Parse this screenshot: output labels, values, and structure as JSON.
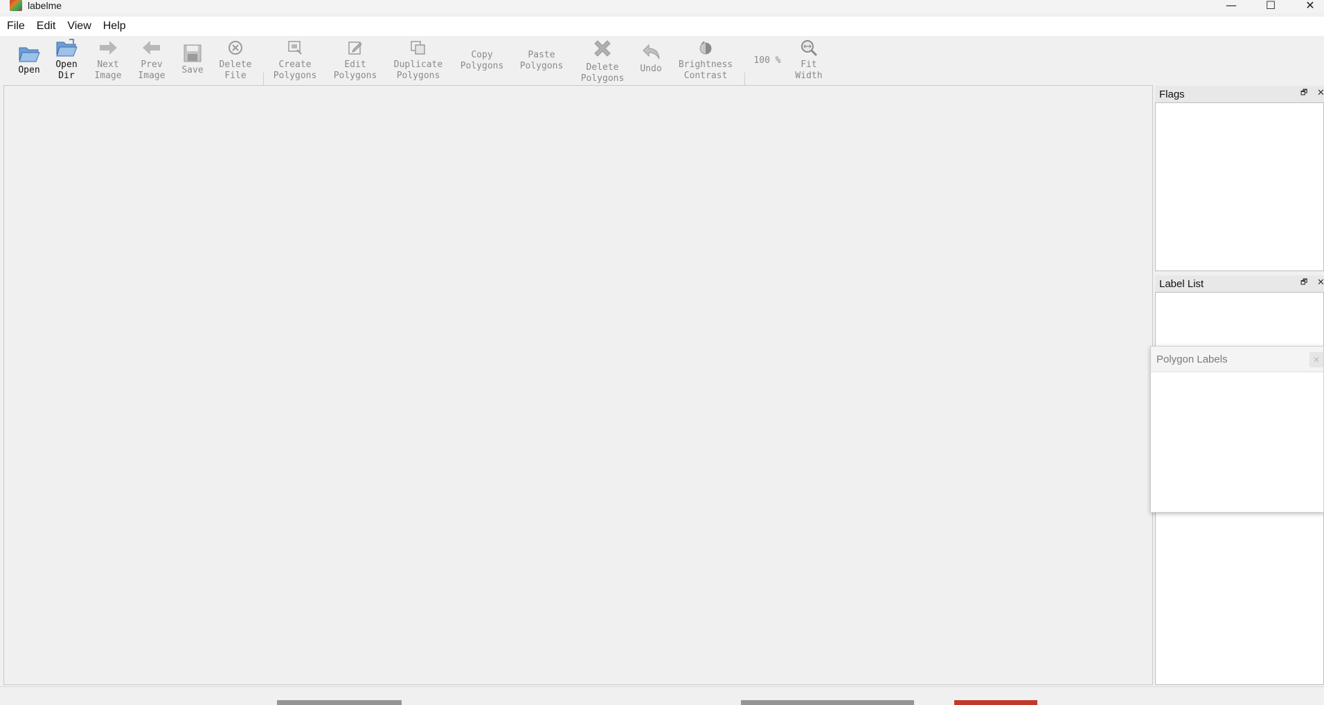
{
  "window": {
    "title": "labelme",
    "minimize_glyph": "—",
    "maximize_glyph": "☐",
    "close_glyph": "✕"
  },
  "menu": {
    "items": [
      "File",
      "Edit",
      "View",
      "Help"
    ]
  },
  "toolbar": {
    "buttons": [
      {
        "line1": "Open",
        "line2": "",
        "icon": "open-folder-icon",
        "enabled": true
      },
      {
        "line1": "Open",
        "line2": "Dir",
        "icon": "open-dir-icon",
        "enabled": true
      },
      {
        "line1": "Next",
        "line2": "Image",
        "icon": "arrow-right-icon",
        "enabled": false
      },
      {
        "line1": "Prev",
        "line2": "Image",
        "icon": "arrow-left-icon",
        "enabled": false
      },
      {
        "line1": "Save",
        "line2": "",
        "icon": "floppy-icon",
        "enabled": false
      },
      {
        "line1": "Delete",
        "line2": "File",
        "icon": "delete-file-icon",
        "enabled": false
      },
      {
        "line1": "Create",
        "line2": "Polygons",
        "icon": "create-polygon-icon",
        "enabled": false
      },
      {
        "line1": "Edit",
        "line2": "Polygons",
        "icon": "edit-polygon-icon",
        "enabled": false
      },
      {
        "line1": "Duplicate",
        "line2": "Polygons",
        "icon": "duplicate-icon",
        "enabled": false
      },
      {
        "line1": "Copy",
        "line2": "Polygons",
        "icon": "",
        "enabled": false
      },
      {
        "line1": "Paste",
        "line2": "Polygons",
        "icon": "",
        "enabled": false
      },
      {
        "line1": "Delete",
        "line2": "Polygons",
        "icon": "delete-x-icon",
        "enabled": false
      },
      {
        "line1": "Undo",
        "line2": "",
        "icon": "undo-icon",
        "enabled": false
      },
      {
        "line1": "Brightness",
        "line2": "Contrast",
        "icon": "brightness-icon",
        "enabled": false
      },
      {
        "line1": "100 %",
        "line2": "",
        "icon": "",
        "enabled": false
      },
      {
        "line1": "Fit",
        "line2": "Width",
        "icon": "zoom-fit-icon",
        "enabled": false
      }
    ]
  },
  "docks": {
    "flags": {
      "title": "Flags",
      "float_glyph": "🗗",
      "close_glyph": "✕"
    },
    "label_list": {
      "title": "Label List",
      "float_glyph": "🗗",
      "close_glyph": "✕"
    },
    "polygon_labels": {
      "title": "Polygon Labels",
      "close_glyph": "✕"
    }
  },
  "colors": {
    "disabled_text": "#8a8a8a",
    "enabled_text": "#111111",
    "icon_blue": "#4a7fc1"
  }
}
